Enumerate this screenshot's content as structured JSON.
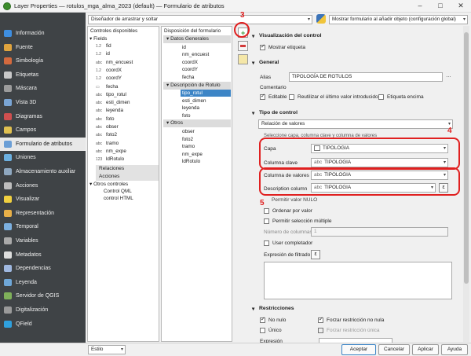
{
  "window": {
    "title": "Layer Properties — rotulos_mga_alma_2023 (default) — Formulario de atributos"
  },
  "sidebar": {
    "items": [
      {
        "label": "Información",
        "color": "#3e8ee0"
      },
      {
        "label": "Fuente",
        "color": "#e0a43e"
      },
      {
        "label": "Simbología",
        "color": "#d46a3e"
      },
      {
        "label": "Etiquetas",
        "color": "#c8c8c8"
      },
      {
        "label": "Máscara",
        "color": "#9c9c9c"
      },
      {
        "label": "Vista 3D",
        "color": "#7aa5d4"
      },
      {
        "label": "Diagramas",
        "color": "#cf4f4f"
      },
      {
        "label": "Campos",
        "color": "#e0c050"
      },
      {
        "label": "Formulario de atributos",
        "color": "#6c9fd6"
      },
      {
        "label": "Uniones",
        "color": "#6cb0e0"
      },
      {
        "label": "Almacenamiento auxiliar",
        "color": "#8fa8c0"
      },
      {
        "label": "Acciones",
        "color": "#bdbdbd"
      },
      {
        "label": "Visualizar",
        "color": "#f0d040"
      },
      {
        "label": "Representación",
        "color": "#e8b048"
      },
      {
        "label": "Temporal",
        "color": "#7cb0e0"
      },
      {
        "label": "Variables",
        "color": "#aaaaaa"
      },
      {
        "label": "Metadatos",
        "color": "#dddddd"
      },
      {
        "label": "Dependencias",
        "color": "#9fb8e0"
      },
      {
        "label": "Leyenda",
        "color": "#6fa7d8"
      },
      {
        "label": "Servidor de QGIS",
        "color": "#7fb05a"
      },
      {
        "label": "Digitalización",
        "color": "#9a9a9a"
      },
      {
        "label": "QField",
        "color": "#2fa0dd"
      }
    ],
    "selected": "Formulario de atributos"
  },
  "top": {
    "designer": "Diseñador de arrastrar y soltar",
    "show_form": "Mostrar formulario al añadir objeto (configuración global)"
  },
  "available": {
    "header": "Controles disponibles",
    "fields_label": "Fields",
    "fields": [
      {
        "pre": "1.2",
        "name": "fid"
      },
      {
        "pre": "1.2",
        "name": "id"
      },
      {
        "pre": "abc",
        "name": "nm_encuest"
      },
      {
        "pre": "1.2",
        "name": "coordX"
      },
      {
        "pre": "1.2",
        "name": "coordY"
      },
      {
        "pre": "▭",
        "name": "fecha"
      },
      {
        "pre": "abc",
        "name": "tipo_rotul"
      },
      {
        "pre": "abc",
        "name": "esti_dimen"
      },
      {
        "pre": "abc",
        "name": "leyenda"
      },
      {
        "pre": "abc",
        "name": "foto"
      },
      {
        "pre": "abc",
        "name": "obser"
      },
      {
        "pre": "abc",
        "name": "foto2"
      },
      {
        "pre": "abc",
        "name": "tramo"
      },
      {
        "pre": "abc",
        "name": "nm_expe"
      },
      {
        "pre": "123",
        "name": "ldRotulo"
      }
    ],
    "relations": "Relaciones",
    "actions": "Acciones",
    "other": "Otros controles",
    "other_items": [
      "Control QML",
      "control HTML"
    ]
  },
  "layout": {
    "header": "Disposición del formulario",
    "groups": [
      {
        "name": "Datos Generales",
        "items": [
          "id",
          "nm_encuest",
          "coordX",
          "coordY",
          "fecha"
        ]
      },
      {
        "name": "Descripción de Rotulo",
        "items": [
          "tipo_rotul",
          "esti_dimen",
          "leyenda",
          "foto"
        ]
      },
      {
        "name": "Otros",
        "items": [
          "obser",
          "foto2",
          "tramo",
          "nm_expe",
          "ldRotulo"
        ]
      }
    ],
    "selected_item": "tipo_rotul"
  },
  "right": {
    "sec_visual": "Visualización del control",
    "show_label": "Mostrar etiqueta",
    "sec_general": "General",
    "alias_label": "Alias",
    "alias_value": "TIPOLOGÍA DE ROTULOS",
    "comment_label": "Comentario",
    "editable": "Editable",
    "reuse": "Reutilizar el último valor introducido",
    "label_on_top": "Etiqueta encima",
    "sec_type": "Tipo de control",
    "widget_type": "Relación de valores",
    "hint": "Seleccione capa, columna clave y columna de valores",
    "layer_label": "Capa",
    "layer_value": "TIPOLOGIA",
    "key_label": "Columna clave",
    "key_value": "TIPOLOGIA",
    "value_label": "Columna de valores",
    "value_value": "TIPOLOGIA",
    "desc_label": "Description column",
    "desc_value": "TIPOLOGIA",
    "allow_null": "Permitir valor NULO",
    "order": "Ordenar por valor",
    "multi": "Permitir selección múltiple",
    "ncols_label": "Número de columnas",
    "ncols_value": "1",
    "autocomplete": "User completador",
    "filter_label": "Expresión de filtrado",
    "sec_restr": "Restricciones",
    "notnull": "No nulo",
    "enforce_notnull": "Forzar restricción no nula",
    "unique": "Único",
    "enforce_unique": "Forzar restricción única",
    "expression": "Expresión"
  },
  "annotations": {
    "n3": "3",
    "n4": "4",
    "n5": "5"
  },
  "footer": {
    "style": "Estilo",
    "accept": "Aceptar",
    "cancel": "Cancelar",
    "apply": "Aplicar",
    "help": "Ayuda"
  },
  "colors": {
    "sidebar": "#3f4346",
    "selection": "#3d85c6",
    "annotation": "#e02020"
  }
}
